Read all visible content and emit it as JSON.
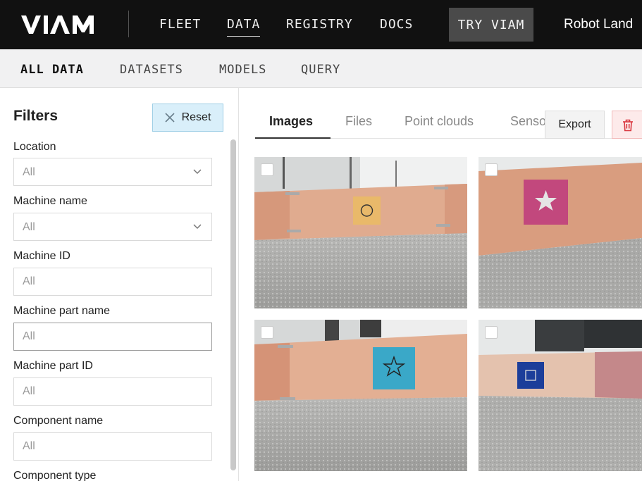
{
  "topnav": {
    "logo_text": "VIAM",
    "items": [
      {
        "label": "FLEET"
      },
      {
        "label": "DATA"
      },
      {
        "label": "REGISTRY"
      },
      {
        "label": "DOCS"
      }
    ],
    "active_item": "DATA",
    "try_button": "TRY VIAM",
    "org_name": "Robot Land"
  },
  "subnav": {
    "items": [
      {
        "label": "ALL DATA"
      },
      {
        "label": "DATASETS"
      },
      {
        "label": "MODELS"
      },
      {
        "label": "QUERY"
      }
    ],
    "active_item": "ALL DATA"
  },
  "sidebar": {
    "title": "Filters",
    "reset_label": "Reset",
    "fields": [
      {
        "label": "Location",
        "placeholder": "All",
        "type": "select"
      },
      {
        "label": "Machine name",
        "placeholder": "All",
        "type": "select"
      },
      {
        "label": "Machine ID",
        "placeholder": "All",
        "type": "text"
      },
      {
        "label": "Machine part name",
        "placeholder": "All",
        "type": "text"
      },
      {
        "label": "Machine part ID",
        "placeholder": "All",
        "type": "text"
      },
      {
        "label": "Component name",
        "placeholder": "All",
        "type": "text"
      },
      {
        "label": "Component type",
        "placeholder": "",
        "type": "text"
      }
    ]
  },
  "main": {
    "tabs": [
      {
        "label": "Images"
      },
      {
        "label": "Files"
      },
      {
        "label": "Point clouds"
      },
      {
        "label": "Sensors"
      }
    ],
    "active_tab": "Images",
    "export_label": "Export",
    "delete_icon": "trash-icon",
    "images": [
      {
        "shape": "circle-icon",
        "tag_color": "#e9b96a"
      },
      {
        "shape": "star-icon",
        "tag_color": "#c2487d"
      },
      {
        "shape": "star-outline-icon",
        "tag_color": "#3aa8c8"
      },
      {
        "shape": "square-icon",
        "tag_color": "#1c3e9a"
      }
    ]
  },
  "colors": {
    "topnav_bg": "#111111",
    "reset_bg": "#d9effa",
    "delete_bg": "#fdeaea"
  }
}
